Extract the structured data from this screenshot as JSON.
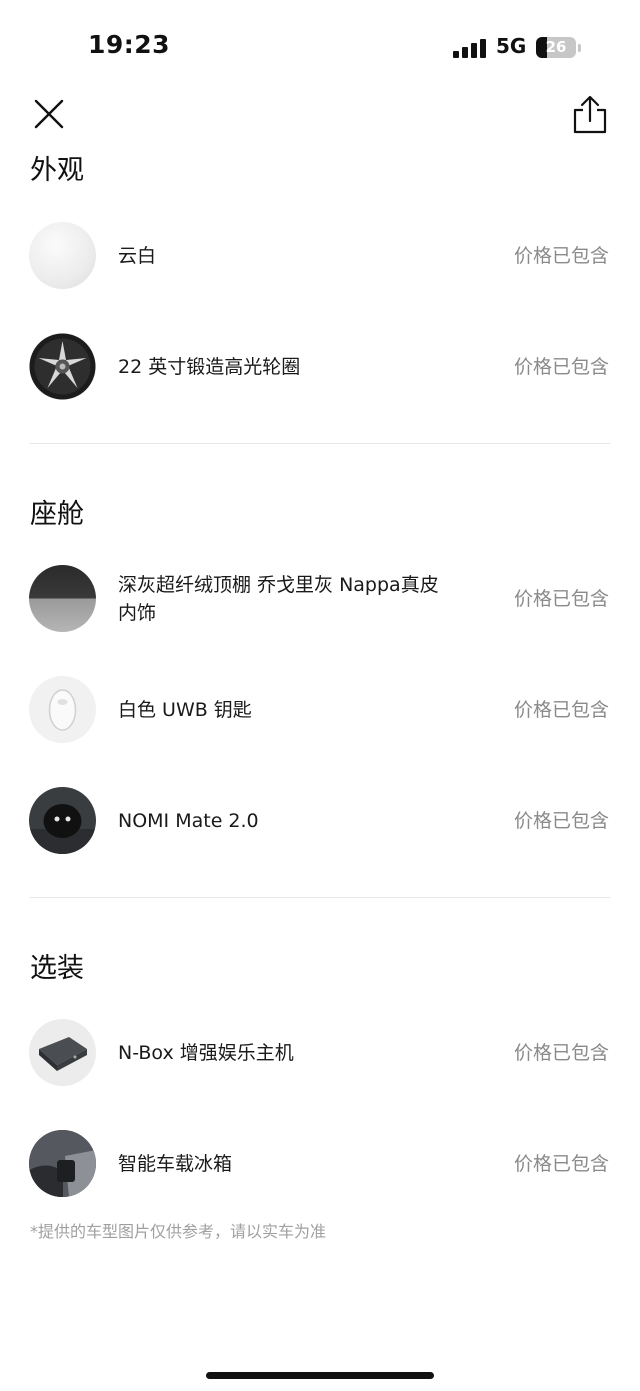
{
  "status_bar": {
    "time": "19:23",
    "network": "5G",
    "battery_level": "26"
  },
  "sections": [
    {
      "title": "外观",
      "items": [
        {
          "name": "云白",
          "price": "价格已包含",
          "thumb": "white-paint-swatch"
        },
        {
          "name": "22 英寸锻造高光轮圈",
          "price": "价格已包含",
          "thumb": "wheel-rim-image"
        }
      ]
    },
    {
      "title": "座舱",
      "items": [
        {
          "name": "深灰超纤绒顶棚 乔戈里灰 Nappa真皮内饰",
          "price": "价格已包含",
          "thumb": "interior-color-swatch"
        },
        {
          "name": "白色 UWB 钥匙",
          "price": "价格已包含",
          "thumb": "uwb-key-image"
        },
        {
          "name": "NOMI Mate 2.0",
          "price": "价格已包含",
          "thumb": "nomi-mate-image"
        }
      ]
    },
    {
      "title": "选装",
      "items": [
        {
          "name": "N-Box 增强娱乐主机",
          "price": "价格已包含",
          "thumb": "nbox-image"
        },
        {
          "name": "智能车载冰箱",
          "price": "价格已包含",
          "thumb": "car-fridge-image"
        }
      ]
    }
  ],
  "footnote": "*提供的车型图片仅供参考，请以实车为准",
  "icons": {
    "close": "close-icon",
    "share": "share-icon"
  }
}
